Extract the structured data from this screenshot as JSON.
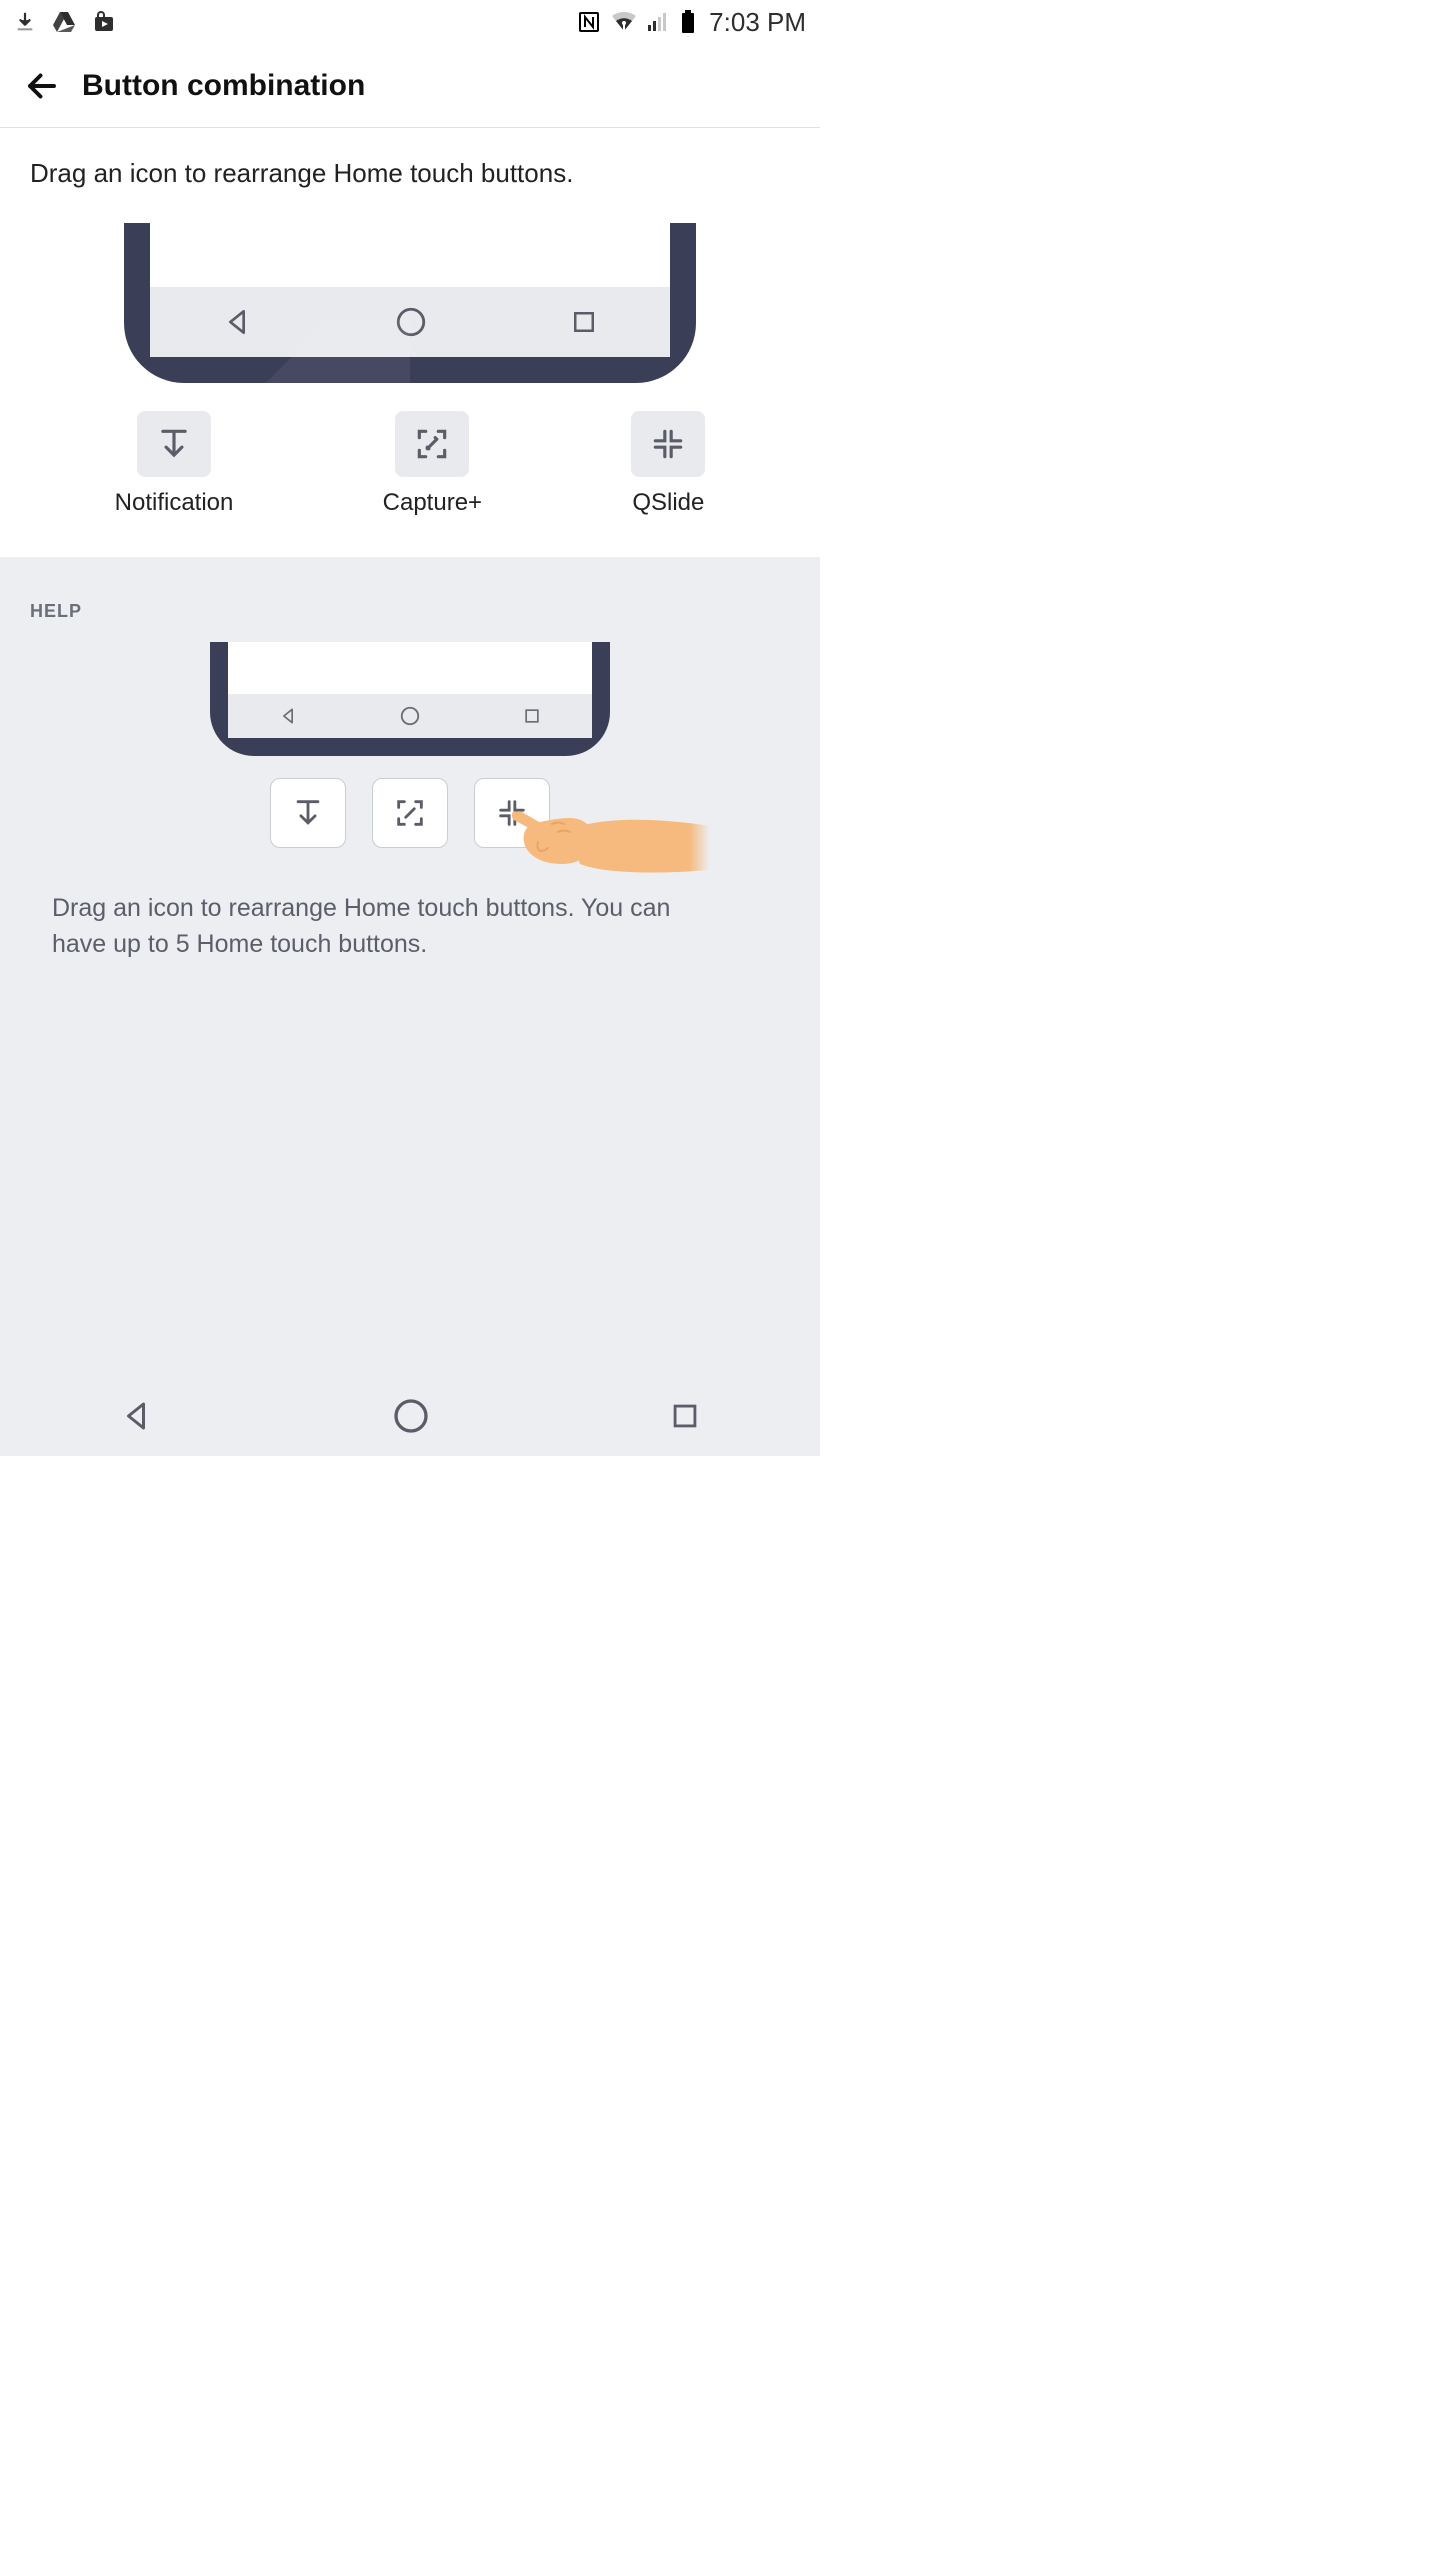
{
  "status_bar": {
    "time": "7:03 PM"
  },
  "app_bar": {
    "title": "Button combination"
  },
  "editor": {
    "instruction": "Drag an icon to rearrange Home touch buttons.",
    "tiles": {
      "notification": "Notification",
      "capture": "Capture+",
      "qslide": "QSlide"
    }
  },
  "help": {
    "header": "HELP",
    "description": "Drag an icon to rearrange Home touch buttons. You can have up to 5 Home touch buttons."
  }
}
